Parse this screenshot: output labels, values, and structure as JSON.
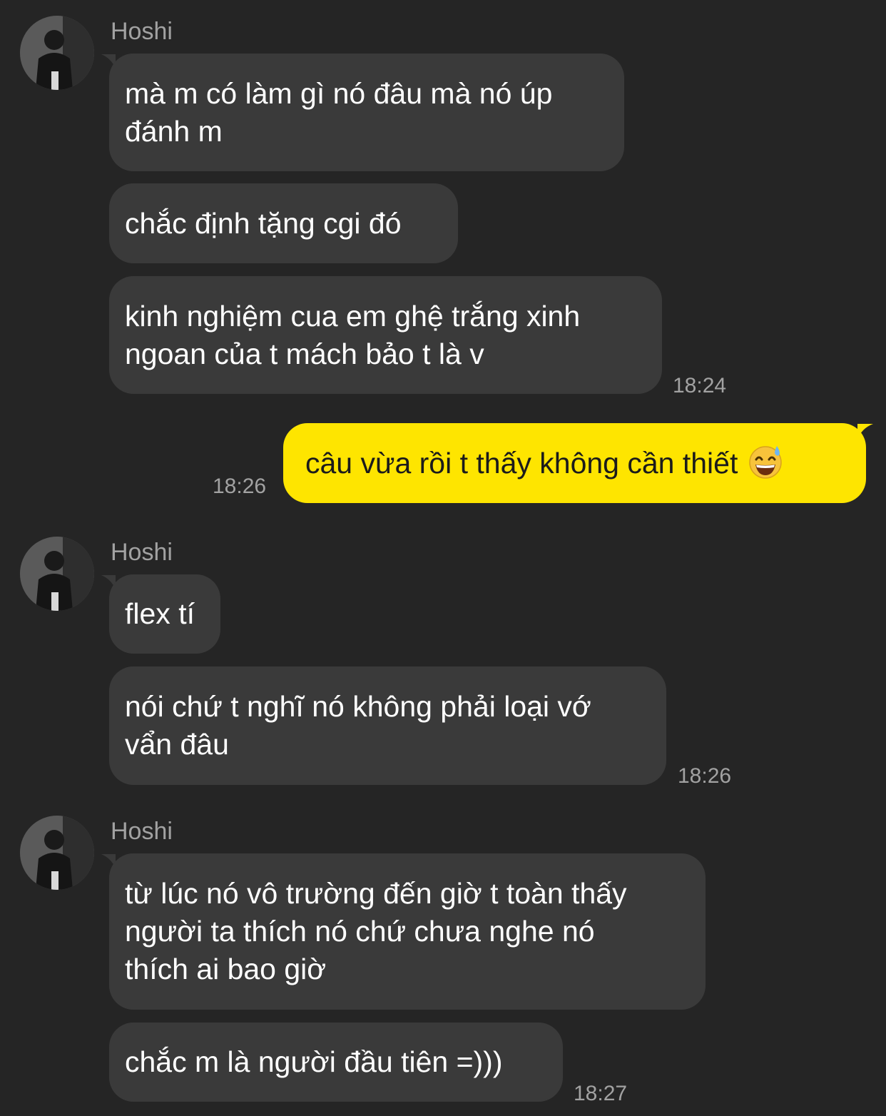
{
  "chat": {
    "groups": [
      {
        "sender": "Hoshi",
        "messages": [
          "mà m có làm gì nó đâu mà nó úp\nđánh m",
          "chắc định tặng cgi đó",
          "kinh nghiệm cua em ghệ trắng xinh\nngoan của t mách bảo t là v"
        ],
        "time": "18:24"
      },
      {
        "outgoing": true,
        "messages": [
          "câu vừa rồi t thấy không cần thiết"
        ],
        "emoji": "grinning-face-with-sweat",
        "time": "18:26"
      },
      {
        "sender": "Hoshi",
        "messages": [
          "flex tí",
          "nói chứ t nghĩ nó không phải loại vớ\nvẩn đâu"
        ],
        "time": "18:26"
      },
      {
        "sender": "Hoshi",
        "messages": [
          "từ lúc nó vô trường đến giờ t toàn thấy\nngười ta thích nó chứ chưa nghe nó\nthích ai bao giờ",
          "chắc m là người đầu tiên =)))"
        ],
        "time": "18:27"
      }
    ]
  },
  "colors": {
    "background": "#252525",
    "incoming_bubble": "#3a3a3a",
    "outgoing_bubble": "#fee500",
    "meta_text": "#a2a2a2"
  }
}
